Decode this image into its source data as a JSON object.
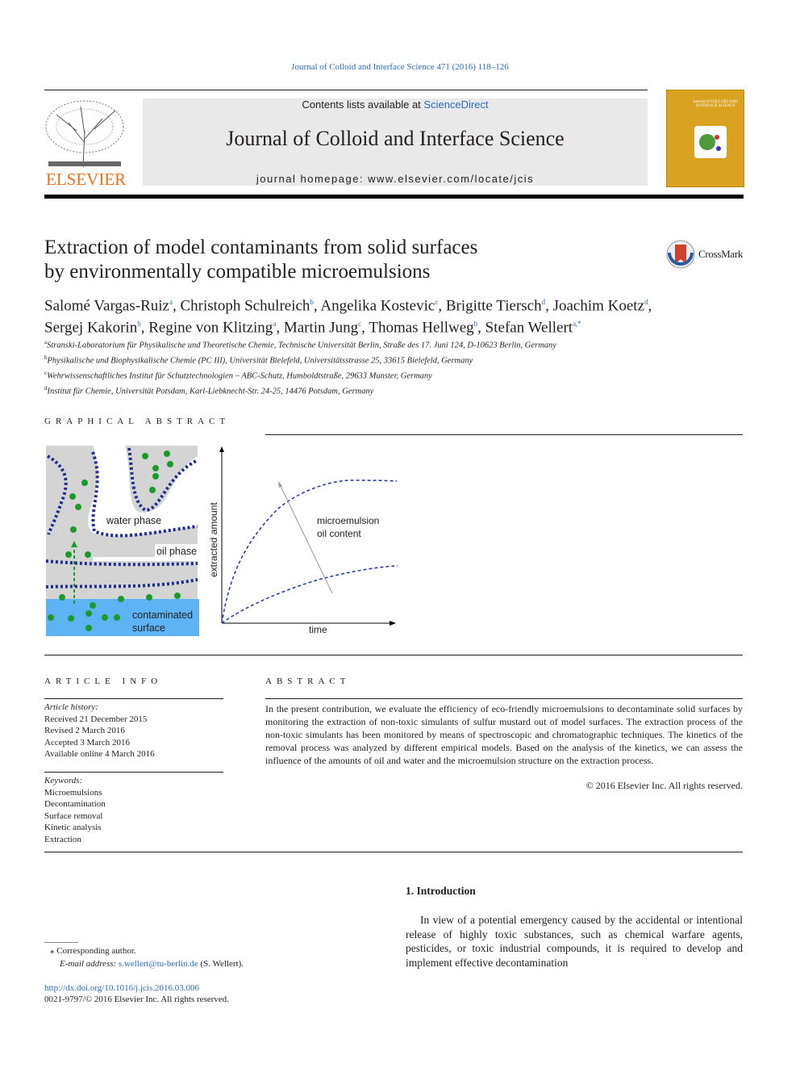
{
  "header": {
    "citation": "Journal of Colloid and Interface Science 471 (2016) 118–126",
    "contents_prefix": "Contents lists available at ",
    "sciencedirect": "ScienceDirect",
    "journal_title": "Journal of Colloid and Interface Science",
    "homepage_prefix": "journal homepage: ",
    "homepage_url": "www.elsevier.com/locate/jcis",
    "publisher": "ELSEVIER",
    "cover_text": "Journal of COLLOID AND INTERFACE SCIENCE"
  },
  "article": {
    "title_line1": "Extraction of model contaminants from solid surfaces",
    "title_line2": "by environmentally compatible microemulsions",
    "crossmark": "CrossMark",
    "authors_line1": [
      {
        "name": "Salomé Vargas-Ruiz",
        "aff": "a"
      },
      {
        "name": "Christoph Schulreich",
        "aff": "b"
      },
      {
        "name": "Angelika Kostevic",
        "aff": "c"
      },
      {
        "name": "Brigitte Tiersch",
        "aff": "d"
      },
      {
        "name": "Joachim Koetz",
        "aff": "d"
      }
    ],
    "authors_line2": [
      {
        "name": "Sergej Kakorin",
        "aff": "b"
      },
      {
        "name": "Regine von Klitzing",
        "aff": "a"
      },
      {
        "name": "Martin Jung",
        "aff": "c"
      },
      {
        "name": "Thomas Hellweg",
        "aff": "b"
      },
      {
        "name": "Stefan Wellert",
        "aff": "a,*"
      }
    ],
    "affiliations": [
      {
        "key": "a",
        "text": "Stranski-Laboratorium für Physikalische und Theoretische Chemie, Technische Universität Berlin, Straße des 17. Juni 124, D-10623 Berlin, Germany"
      },
      {
        "key": "b",
        "text": "Physikalische und Biophysikalische Chemie (PC III), Universität Bielefeld, Universitätsstrasse 25, 33615 Bielefeld, Germany"
      },
      {
        "key": "c",
        "text": "Wehrwissenschaftliches Institut für Schutztechnologien – ABC-Schutz, Humboldtstraße, 29633 Munster, Germany"
      },
      {
        "key": "d",
        "text": "Institut für Chemie, Universität Potsdam, Karl-Liebknecht-Str. 24-25, 14476 Potsdam, Germany"
      }
    ]
  },
  "graphical_abstract": {
    "heading": "GRAPHICAL ABSTRACT",
    "water_phase": "water phase",
    "oil_phase": "oil phase",
    "surface_line1": "contaminated",
    "surface_line2": "surface",
    "ylabel": "extracted amount",
    "xlabel": "time",
    "annot_line1": "microemulsion",
    "annot_line2": "oil content",
    "colors": {
      "surfactant": "#1f2f8f",
      "contaminant": "#1a9a2a",
      "surface": "#5eb3f5",
      "phase": "#d4d4d4"
    }
  },
  "article_info": {
    "heading": "ARTICLE INFO",
    "history_label": "Article history:",
    "history": [
      "Received 21 December 2015",
      "Revised 2 March 2016",
      "Accepted 3 March 2016",
      "Available online 4 March 2016"
    ],
    "keywords_label": "Keywords:",
    "keywords": [
      "Microemulsions",
      "Decontamination",
      "Surface removal",
      "Kinetic analysis",
      "Extraction"
    ]
  },
  "abstract": {
    "heading": "ABSTRACT",
    "text": "In the present contribution, we evaluate the efficiency of eco-friendly microemulsions to decontaminate solid surfaces by monitoring the extraction of non-toxic simulants of sulfur mustard out of model surfaces. The extraction process of the non-toxic simulants has been monitored by means of spectroscopic and chromatographic techniques. The kinetics of the removal process was analyzed by different empirical models. Based on the analysis of the kinetics, we can assess the influence of the amounts of oil and water and the microemulsion structure on the extraction process.",
    "copyright": "© 2016 Elsevier Inc. All rights reserved."
  },
  "footnote": {
    "corresponding": "Corresponding author.",
    "email_label": "E-mail address: ",
    "email": "s.wellert@tu-berlin.de",
    "email_suffix": " (S. Wellert).",
    "doi": "http://dx.doi.org/10.1016/j.jcis.2016.03.006",
    "issn": "0021-9797/© 2016 Elsevier Inc. All rights reserved."
  },
  "intro": {
    "heading": "1. Introduction",
    "text": "In view of a potential emergency caused by the accidental or intentional release of highly toxic substances, such as chemical warfare agents, pesticides, or toxic industrial compounds, it is required to develop and implement effective decontamination"
  }
}
